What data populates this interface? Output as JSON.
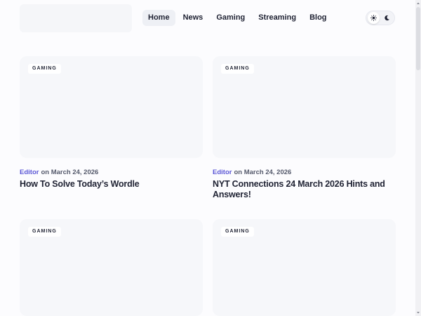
{
  "nav": {
    "items": [
      {
        "label": "Home",
        "active": true
      },
      {
        "label": "News"
      },
      {
        "label": "Gaming"
      },
      {
        "label": "Streaming"
      },
      {
        "label": "Blog"
      }
    ]
  },
  "theme_toggle": {
    "light_icon": "sun-icon",
    "dark_icon": "moon-icon",
    "selected": "light"
  },
  "posts": [
    {
      "category": "GAMING",
      "author": "Editor",
      "date_text": "on March 24, 2026",
      "title": "How To Solve Today’s Wordle"
    },
    {
      "category": "GAMING",
      "author": "Editor",
      "date_text": "on March 24, 2026",
      "title": "NYT Connections 24 March 2026 Hints and Answers!"
    },
    {
      "category": "GAMING"
    },
    {
      "category": "GAMING"
    }
  ],
  "colors": {
    "accent": "#5b57d6",
    "text": "#1f2233",
    "card_bg": "#f6f7fa"
  }
}
